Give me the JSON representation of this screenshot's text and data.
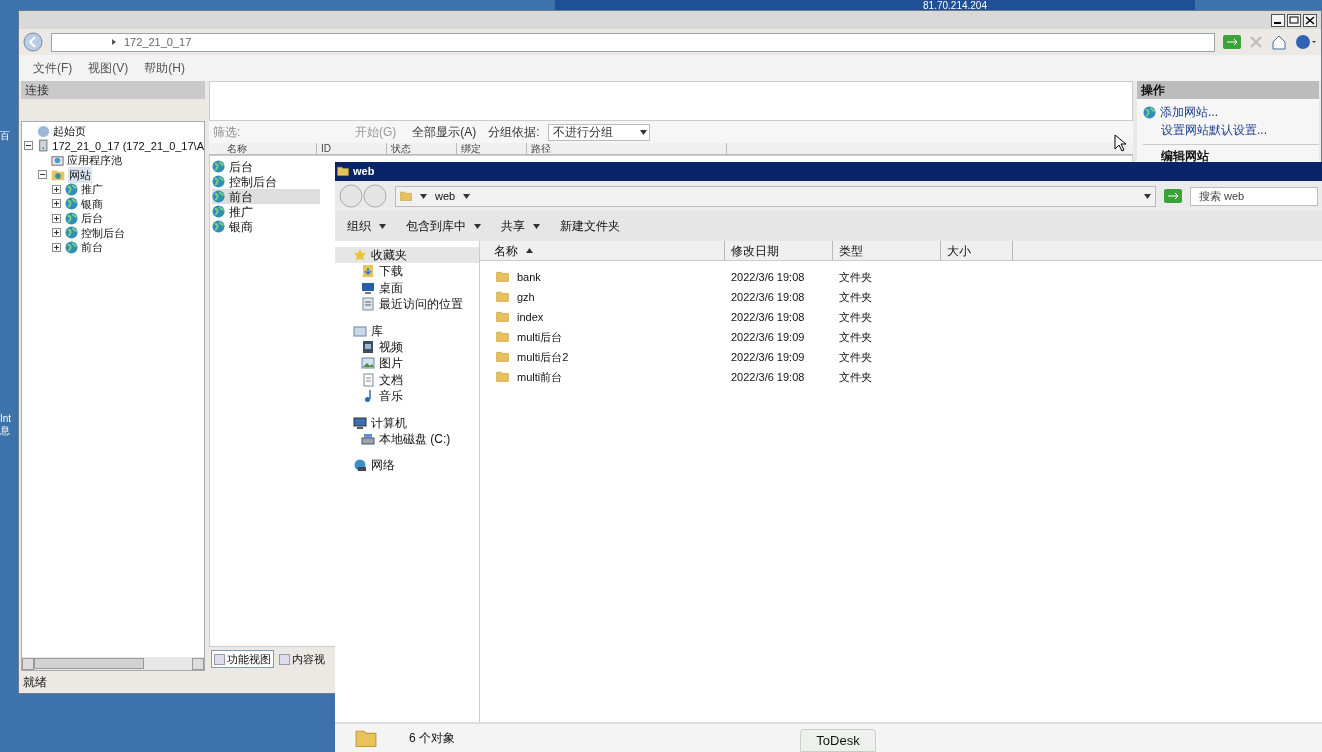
{
  "remote_bar": {
    "address": "81.70.214.204"
  },
  "desktop": {
    "icon_labels": [
      "百",
      "Int",
      "息"
    ]
  },
  "iis": {
    "breadcrumb": "172_21_0_17",
    "menu": [
      "文件(F)",
      "视图(V)",
      "帮助(H)"
    ],
    "connections": {
      "title": "连接",
      "tree": [
        {
          "label": "起始页",
          "kind": "page",
          "selected": false
        },
        {
          "label": "172_21_0_17 (172_21_0_17\\A",
          "kind": "server",
          "selected": false,
          "expanded": true,
          "children": [
            {
              "label": "应用程序池",
              "kind": "pool",
              "selected": false
            },
            {
              "label": "网站",
              "kind": "sites",
              "selected": true,
              "expanded": true,
              "children": [
                {
                  "label": "推广",
                  "kind": "site",
                  "selected": false,
                  "expanded": false
                },
                {
                  "label": "银商",
                  "kind": "site",
                  "selected": false,
                  "expanded": false
                },
                {
                  "label": "后台",
                  "kind": "site",
                  "selected": false,
                  "expanded": false
                },
                {
                  "label": "控制后台",
                  "kind": "site",
                  "selected": false,
                  "expanded": false
                },
                {
                  "label": "前台",
                  "kind": "site",
                  "selected": false,
                  "expanded": false
                }
              ]
            }
          ]
        }
      ]
    },
    "filter": {
      "label": "筛选:",
      "go": "开始(G)",
      "show_all": "全部显示(A)",
      "group_label": "分组依据:",
      "group_value": "不进行分组"
    },
    "columns": [
      "名称",
      "ID",
      "状态",
      "绑定",
      "路径"
    ],
    "sites": [
      {
        "name": "后台",
        "selected": false
      },
      {
        "name": "控制后台",
        "selected": false
      },
      {
        "name": "前台",
        "selected": true
      },
      {
        "name": "推广",
        "selected": false
      },
      {
        "name": "银商",
        "selected": false
      }
    ],
    "view_tabs": [
      {
        "label": "功能视图",
        "selected": true
      },
      {
        "label": "内容视",
        "selected": false
      }
    ],
    "status": "就绪",
    "actions": {
      "title": "操作",
      "links": [
        "添加网站...",
        "设置网站默认设置..."
      ],
      "section": "编辑网站"
    }
  },
  "explorer": {
    "title": "web",
    "path": "web",
    "search_placeholder": "搜索 web",
    "toolbar": [
      {
        "label": "组织",
        "dropdown": true
      },
      {
        "label": "包含到库中",
        "dropdown": true
      },
      {
        "label": "共享",
        "dropdown": true
      },
      {
        "label": "新建文件夹",
        "dropdown": false
      }
    ],
    "nav": [
      {
        "label": "收藏夹",
        "kind": "star",
        "selected": true,
        "children": [
          {
            "label": "下载",
            "kind": "download",
            "selected": false
          },
          {
            "label": "桌面",
            "kind": "desktop",
            "selected": false
          },
          {
            "label": "最近访问的位置",
            "kind": "recent",
            "selected": false
          }
        ]
      },
      {
        "label": "库",
        "kind": "library",
        "selected": false,
        "children": [
          {
            "label": "视频",
            "kind": "video",
            "selected": false
          },
          {
            "label": "图片",
            "kind": "picture",
            "selected": false
          },
          {
            "label": "文档",
            "kind": "document",
            "selected": false
          },
          {
            "label": "音乐",
            "kind": "music",
            "selected": false
          }
        ]
      },
      {
        "label": "计算机",
        "kind": "computer",
        "selected": false,
        "children": [
          {
            "label": "本地磁盘 (C:)",
            "kind": "disk",
            "selected": false
          }
        ]
      },
      {
        "label": "网络",
        "kind": "network",
        "selected": false
      }
    ],
    "columns": [
      "名称",
      "修改日期",
      "类型",
      "大小"
    ],
    "files": [
      {
        "name": "bank",
        "modified": "2022/3/6 19:08",
        "type": "文件夹"
      },
      {
        "name": "gzh",
        "modified": "2022/3/6 19:08",
        "type": "文件夹"
      },
      {
        "name": "index",
        "modified": "2022/3/6 19:08",
        "type": "文件夹"
      },
      {
        "name": "multi后台",
        "modified": "2022/3/6 19:09",
        "type": "文件夹"
      },
      {
        "name": "multi后台2",
        "modified": "2022/3/6 19:09",
        "type": "文件夹"
      },
      {
        "name": "multi前台",
        "modified": "2022/3/6 19:08",
        "type": "文件夹"
      }
    ],
    "status": "6 个对象"
  },
  "taskbar_button": "ToDesk"
}
